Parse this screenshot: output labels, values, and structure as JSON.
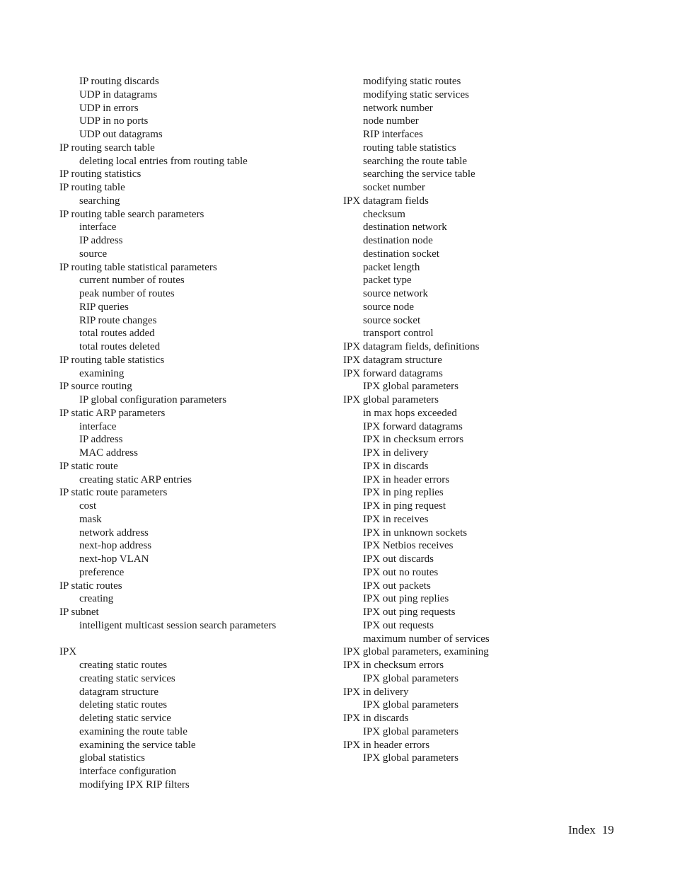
{
  "page": {
    "section": "Index",
    "number": "19"
  },
  "left_column": [
    {
      "text": "IP routing discards",
      "level": 1
    },
    {
      "text": "UDP in datagrams",
      "level": 1
    },
    {
      "text": "UDP in errors",
      "level": 1
    },
    {
      "text": "UDP in no ports",
      "level": 1
    },
    {
      "text": "UDP out datagrams",
      "level": 1
    },
    {
      "text": "IP routing search table",
      "level": 0
    },
    {
      "text": "deleting local entries from routing table",
      "level": 1
    },
    {
      "text": "IP routing statistics",
      "level": 0
    },
    {
      "text": "IP routing table",
      "level": 0
    },
    {
      "text": "searching",
      "level": 1
    },
    {
      "text": "IP routing table search parameters",
      "level": 0
    },
    {
      "text": "interface",
      "level": 1
    },
    {
      "text": "IP address",
      "level": 1
    },
    {
      "text": "source",
      "level": 1
    },
    {
      "text": "IP routing table statistical parameters",
      "level": 0
    },
    {
      "text": "current number of routes",
      "level": 1
    },
    {
      "text": "peak number of routes",
      "level": 1
    },
    {
      "text": "RIP queries",
      "level": 1
    },
    {
      "text": "RIP route changes",
      "level": 1
    },
    {
      "text": "total routes added",
      "level": 1
    },
    {
      "text": "total routes deleted",
      "level": 1
    },
    {
      "text": "IP routing table statistics",
      "level": 0
    },
    {
      "text": "examining",
      "level": 1
    },
    {
      "text": "IP source routing",
      "level": 0
    },
    {
      "text": "IP global configuration parameters",
      "level": 1
    },
    {
      "text": "IP static ARP parameters",
      "level": 0
    },
    {
      "text": "interface",
      "level": 1
    },
    {
      "text": "IP address",
      "level": 1
    },
    {
      "text": "MAC address",
      "level": 1
    },
    {
      "text": "IP static route",
      "level": 0
    },
    {
      "text": "creating static ARP entries",
      "level": 1
    },
    {
      "text": "IP static route parameters",
      "level": 0
    },
    {
      "text": "cost",
      "level": 1
    },
    {
      "text": "mask",
      "level": 1
    },
    {
      "text": "network address",
      "level": 1
    },
    {
      "text": "next-hop address",
      "level": 1
    },
    {
      "text": "next-hop VLAN",
      "level": 1
    },
    {
      "text": "preference",
      "level": 1
    },
    {
      "text": "IP static routes",
      "level": 0
    },
    {
      "text": "creating",
      "level": 1
    },
    {
      "text": "IP subnet",
      "level": 0
    },
    {
      "text": "intelligent multicast session search parameters",
      "level": 1
    },
    {
      "text": "",
      "level": -1
    },
    {
      "text": "IPX",
      "level": 0
    },
    {
      "text": "creating static routes",
      "level": 1
    },
    {
      "text": "creating static services",
      "level": 1
    },
    {
      "text": "datagram structure",
      "level": 1
    },
    {
      "text": "deleting static routes",
      "level": 1
    },
    {
      "text": "deleting static service",
      "level": 1
    },
    {
      "text": "examining the route table",
      "level": 1
    },
    {
      "text": "examining the service table",
      "level": 1
    },
    {
      "text": "global statistics",
      "level": 1
    },
    {
      "text": "interface configuration",
      "level": 1
    },
    {
      "text": "modifying IPX RIP filters",
      "level": 1
    }
  ],
  "right_column": [
    {
      "text": "modifying static routes",
      "level": 1
    },
    {
      "text": "modifying static services",
      "level": 1
    },
    {
      "text": "network number",
      "level": 1
    },
    {
      "text": "node number",
      "level": 1
    },
    {
      "text": "RIP interfaces",
      "level": 1
    },
    {
      "text": "routing table statistics",
      "level": 1
    },
    {
      "text": "searching the route table",
      "level": 1
    },
    {
      "text": "searching the service table",
      "level": 1
    },
    {
      "text": "socket number",
      "level": 1
    },
    {
      "text": "IPX datagram fields",
      "level": 0
    },
    {
      "text": "checksum",
      "level": 1
    },
    {
      "text": "destination network",
      "level": 1
    },
    {
      "text": "destination node",
      "level": 1
    },
    {
      "text": "destination socket",
      "level": 1
    },
    {
      "text": "packet length",
      "level": 1
    },
    {
      "text": "packet type",
      "level": 1
    },
    {
      "text": "source network",
      "level": 1
    },
    {
      "text": "source node",
      "level": 1
    },
    {
      "text": "source socket",
      "level": 1
    },
    {
      "text": "transport control",
      "level": 1
    },
    {
      "text": "IPX datagram fields, definitions",
      "level": 0
    },
    {
      "text": "IPX datagram structure",
      "level": 0
    },
    {
      "text": "IPX forward datagrams",
      "level": 0
    },
    {
      "text": "IPX global parameters",
      "level": 1
    },
    {
      "text": "IPX global parameters",
      "level": 0
    },
    {
      "text": "in max hops exceeded",
      "level": 1
    },
    {
      "text": "IPX forward datagrams",
      "level": 1
    },
    {
      "text": "IPX in checksum errors",
      "level": 1
    },
    {
      "text": "IPX in delivery",
      "level": 1
    },
    {
      "text": "IPX in discards",
      "level": 1
    },
    {
      "text": "IPX in header errors",
      "level": 1
    },
    {
      "text": "IPX in ping replies",
      "level": 1
    },
    {
      "text": "IPX in ping request",
      "level": 1
    },
    {
      "text": "IPX in receives",
      "level": 1
    },
    {
      "text": "IPX in unknown sockets",
      "level": 1
    },
    {
      "text": "IPX Netbios receives",
      "level": 1
    },
    {
      "text": "IPX out discards",
      "level": 1
    },
    {
      "text": "IPX out no routes",
      "level": 1
    },
    {
      "text": "IPX out packets",
      "level": 1
    },
    {
      "text": "IPX out ping replies",
      "level": 1
    },
    {
      "text": "IPX out ping requests",
      "level": 1
    },
    {
      "text": "IPX out requests",
      "level": 1
    },
    {
      "text": "maximum number of services",
      "level": 1
    },
    {
      "text": "IPX global parameters, examining",
      "level": 0
    },
    {
      "text": "IPX in checksum errors",
      "level": 0
    },
    {
      "text": "IPX global parameters",
      "level": 1
    },
    {
      "text": "IPX in delivery",
      "level": 0
    },
    {
      "text": "IPX global parameters",
      "level": 1
    },
    {
      "text": "IPX in discards",
      "level": 0
    },
    {
      "text": "IPX global parameters",
      "level": 1
    },
    {
      "text": "IPX in header errors",
      "level": 0
    },
    {
      "text": "IPX global parameters",
      "level": 1
    }
  ]
}
